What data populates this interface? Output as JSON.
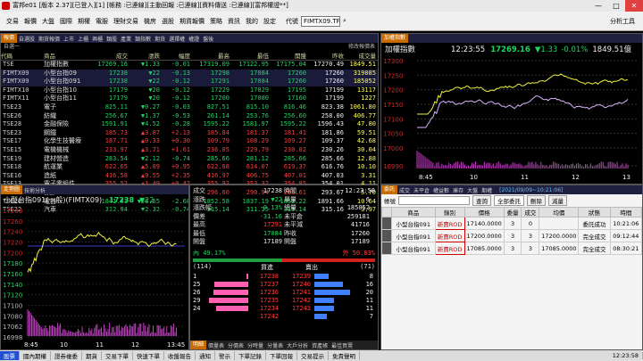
{
  "title": "富邦e01 [版本 2.37][已登入][1] [帳務 :已連線][主動回報 :已連線][資料傳送 :已連線][富邦權證**]",
  "menu": [
    "交易",
    "報價",
    "大盤",
    "國際",
    "期權",
    "電服",
    "理財交易",
    "機房",
    "選股",
    "期貨報價",
    "策略",
    "資訊",
    "我的",
    "設定"
  ],
  "symbol_label": "代號",
  "symbol_value": "FIMTX09.TF",
  "analysis_label": "分析工具",
  "quote": {
    "tabs": [
      "報價",
      "自選股",
      "期貨報價",
      "上市",
      "上櫃",
      "興櫃",
      "類股",
      "產業",
      "類指數",
      "期貨",
      "選擇權",
      "權證",
      "盤後"
    ],
    "subtitle": "自選一",
    "modify": "修改報價表",
    "headers": [
      "代碼",
      "商品",
      "成交",
      "漲跌",
      "幅度",
      "最高",
      "最低",
      "開盤",
      "昨收",
      "成交量"
    ],
    "rows": [
      [
        "TSE",
        "加權指數",
        "17269.16",
        "▼1.33",
        "-0.01",
        "17319.09",
        "17122.95",
        "17175.04",
        "17270.49",
        "1849.51"
      ],
      [
        "FIMTX09",
        "小型台指09",
        "17238",
        "▼22",
        "-0.13",
        "17298",
        "17084",
        "17260",
        "17260",
        "319085"
      ],
      [
        "FIMTX09",
        "小型台指091",
        "17238",
        "▼22",
        "-0.12",
        "17291",
        "17084",
        "17260",
        "17260",
        "185052"
      ],
      [
        "FIMTX10",
        "小型台指10",
        "17179",
        "▼20",
        "-0.12",
        "17229",
        "17029",
        "17195",
        "17199",
        "13117"
      ],
      [
        "FIMTX11",
        "小型台指11",
        "17179",
        "▼20",
        "-0.12",
        "17200",
        "17080",
        "17160",
        "17199",
        "1227"
      ],
      [
        "TSE23",
        "電子",
        "825.11",
        "▼0.27",
        "-0.03",
        "827.51",
        "815.10",
        "816.46",
        "823.38",
        "1061.80"
      ],
      [
        "TSE26",
        "紡織",
        "256.67",
        "▼1.37",
        "-0.53",
        "261.14",
        "253.76",
        "256.60",
        "258.00",
        "406.77"
      ],
      [
        "TSE28",
        "金融保險",
        "1591.91",
        "▼4.52",
        "-0.28",
        "1595.22",
        "1581.97",
        "1595.22",
        "1596.43",
        "47.80"
      ],
      [
        "TSE23",
        "鋼鐵",
        "185.73",
        "▲3.87",
        "+2.13",
        "185.84",
        "181.37",
        "181.41",
        "181.86",
        "59.51"
      ],
      [
        "TSE17",
        "化學生技醫療",
        "187.71",
        "▲0.33",
        "+0.30",
        "109.79",
        "108.29",
        "109.27",
        "109.37",
        "42.68"
      ],
      [
        "TSE15",
        "電機機械",
        "233.97",
        "▲3.71",
        "+1.61",
        "236.05",
        "229.79",
        "230.02",
        "230.26",
        "30.04"
      ],
      [
        "TSE19",
        "建材營造",
        "283.54",
        "▼2.12",
        "-0.74",
        "285.66",
        "281.12",
        "285.66",
        "285.66",
        "12.88"
      ],
      [
        "TSE18",
        "航運業",
        "622.65",
        "▲5.89",
        "+0.95",
        "622.68",
        "614.07",
        "619.37",
        "616.76",
        "10.10"
      ],
      [
        "TSE16",
        "造紙",
        "416.58",
        "▲9.55",
        "+2.35",
        "416.97",
        "406.75",
        "407.01",
        "407.03",
        "3.31"
      ],
      [
        "TSE13",
        "電子零組件",
        "355.52",
        "▲1.49",
        "+0.42",
        "355.92",
        "353.32",
        "354.85",
        "354.01",
        "4.11"
      ],
      [
        "TSE11",
        "橡膠",
        "295.98",
        "▲2.27",
        "+0.77",
        "296.60",
        "290.94",
        "293.61",
        "293.67",
        "5.70"
      ],
      [
        "TSE26",
        "電器",
        "1841.01",
        "▼56.65",
        "-2.68",
        "1852.58",
        "1837.19",
        "1852.22",
        "1891.66",
        "10.64"
      ],
      [
        "TSE22",
        "汽車",
        "312.84",
        "▼2.32",
        "-0.74",
        "315.14",
        "311.35",
        "315.14",
        "315.16",
        "3.97"
      ]
    ]
  },
  "mini": {
    "tab": "加權指數",
    "name": "加權指數",
    "time": "12:23:55",
    "price": "17269.16",
    "chg": "▼1.33",
    "pct": "-0.01%",
    "vol": "1849.51億",
    "yticks": [
      "17300",
      "17250",
      "17200",
      "17150",
      "17100",
      "17050",
      "17000",
      "16990"
    ],
    "xticks": [
      "8:45",
      "10",
      "11",
      "12",
      "13"
    ]
  },
  "big": {
    "tabs": [
      "走勢圖",
      "技術分析"
    ],
    "name": "小型台指091(一般)(FIMTX09)",
    "price": "17238",
    "chg": "▼22",
    "yticks": [
      "17280",
      "17260",
      "17240",
      "17220",
      "17200",
      "17180",
      "17160",
      "17140",
      "17120",
      "17100",
      "17080",
      "17062",
      "16998"
    ],
    "xticks": [
      "8:45",
      "10",
      "11",
      "12",
      "13:45"
    ]
  },
  "detail": {
    "time": "12:23:58",
    "left": [
      [
        "成交",
        "17238"
      ],
      [
        "漲跌",
        "▼22"
      ],
      [
        "漲跌幅",
        "-0.13%"
      ],
      [
        "價差",
        "-31.16"
      ],
      [
        "最高",
        "17291"
      ],
      [
        "最低",
        "17084"
      ],
      [
        "開盤",
        "17189"
      ]
    ],
    "right": [
      [
        "時間",
        ""
      ],
      [
        "單量",
        "6"
      ],
      [
        "總量",
        "185052"
      ],
      [
        "未平倉",
        "259181"
      ],
      [
        "未平減",
        "41716"
      ],
      [
        "昨收",
        "17260"
      ],
      [
        "開盤",
        "17189"
      ]
    ],
    "inside": "內 49.17%",
    "outside": "外 50.83%",
    "bidhdr": "(114)",
    "askhdr": "(71)",
    "bidlabel": "買進",
    "asklabel": "賣出",
    "book": [
      [
        "1",
        "17238",
        "17239",
        "8"
      ],
      [
        "25",
        "17237",
        "17240",
        "16"
      ],
      [
        "26",
        "17236",
        "17241",
        "20"
      ],
      [
        "29",
        "17235",
        "17242",
        "11"
      ],
      [
        "24",
        "17234",
        "17243",
        "11"
      ],
      [
        "",
        "17242",
        "",
        "7"
      ]
    ],
    "bottomtabs": [
      "明細",
      "價量表",
      "分價表",
      "分時量",
      "分量表",
      "大戶分析",
      "資產帳",
      "最佳買賣"
    ]
  },
  "orders": {
    "tabs": [
      "委託",
      "成交",
      "未平倉",
      "權益數",
      "庫存",
      "大盤",
      "期權"
    ],
    "date": "[2021/09/09~10:21:06]",
    "account_label": "帳號",
    "query": "查詢",
    "filter": "全部委託",
    "delete": "刪除",
    "modify": "減量",
    "headers": [
      "",
      "商品",
      "錄別",
      "價格",
      "委量",
      "成交",
      "均價",
      "狀態",
      "時間"
    ],
    "rows": [
      [
        "",
        "小型台指091",
        "新賣ROD",
        "17140.0000",
        "3",
        "0",
        "",
        "委託成功",
        "10:21:06"
      ],
      [
        "",
        "小型台指091",
        "新賣ROD",
        "17200.0000",
        "3",
        "3",
        "17200.0000",
        "完全成交",
        "09:12:44"
      ],
      [
        "",
        "小型台指091",
        "新賣ROD",
        "17085.0000",
        "3",
        "3",
        "17085.0000",
        "完全成交",
        "08:30:21"
      ]
    ]
  },
  "status": [
    "股票",
    "國內期權",
    "證券複委",
    "期貨",
    "交易下單",
    "快速下單",
    "收盤報告",
    "通知",
    "警示",
    "下單記錄",
    "下單回報",
    "交易提示",
    "免責聲明",
    "12:23:58"
  ],
  "colors": {
    "up": "#ff3c3c",
    "down": "#1ed760",
    "flat": "#ffff50"
  }
}
